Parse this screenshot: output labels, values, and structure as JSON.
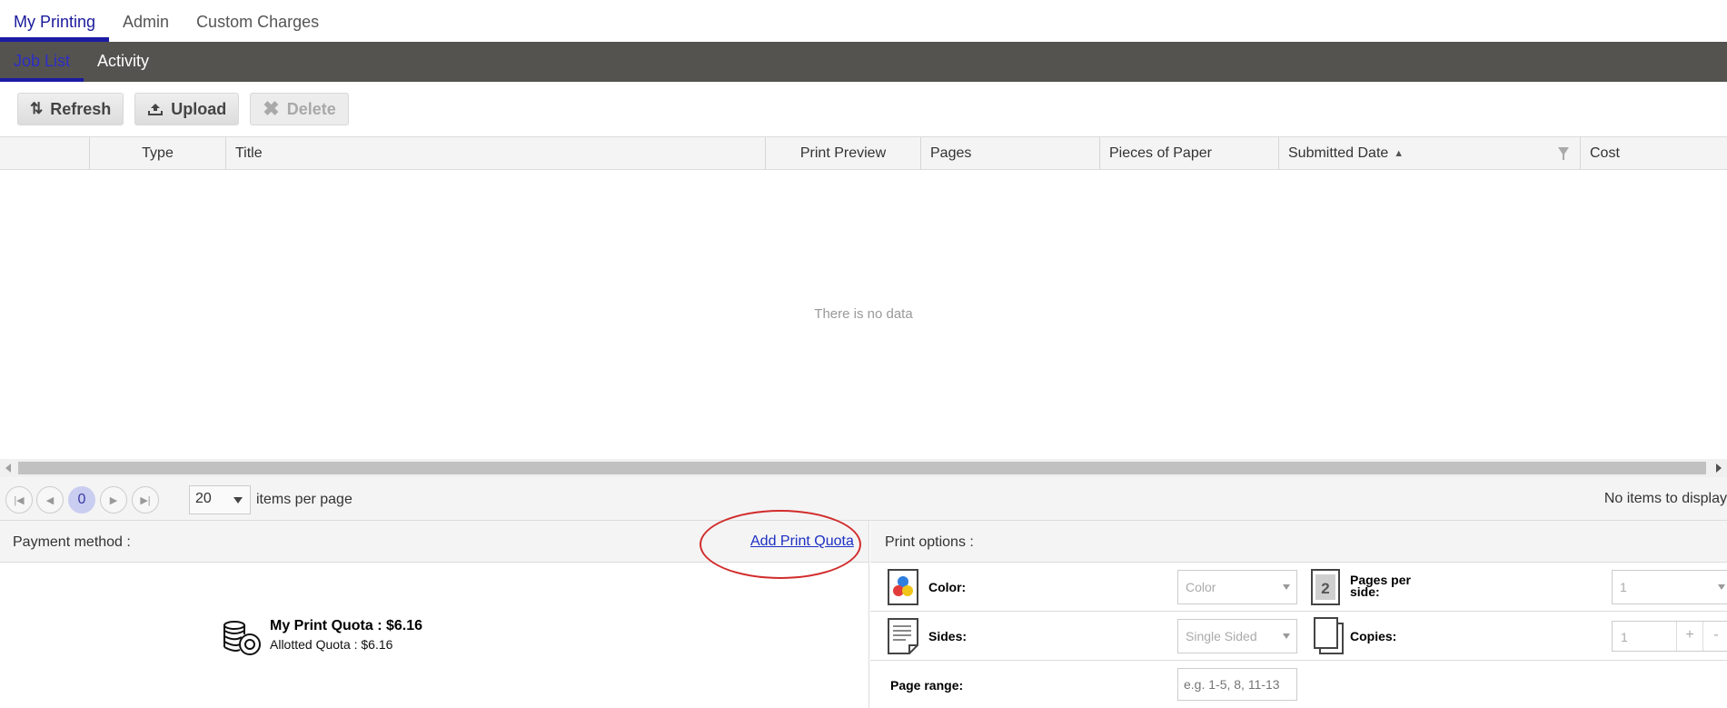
{
  "top_tabs": [
    "My Printing",
    "Admin",
    "Custom Charges"
  ],
  "sub_tabs": [
    "Job List",
    "Activity"
  ],
  "toolbar": {
    "refresh": "Refresh",
    "upload": "Upload",
    "delete": "Delete"
  },
  "grid": {
    "columns": [
      "Type",
      "Title",
      "Print Preview",
      "Pages",
      "Pieces of Paper",
      "Submitted Date",
      "Cost"
    ],
    "empty_message": "There is no data"
  },
  "pager": {
    "current_page": "0",
    "page_size": "20",
    "items_per_page_label": "items per page",
    "status": "No items to display"
  },
  "payment": {
    "label": "Payment method :",
    "add_quota_link": "Add Print Quota",
    "quota_title": "My Print Quota : $6.16",
    "quota_allotted": "Allotted Quota : $6.16"
  },
  "print_options": {
    "label": "Print options :",
    "color_label": "Color:",
    "color_value": "Color",
    "pages_per_side_label": "Pages per side:",
    "pages_per_side_value": "1",
    "pages_per_side_icon_text": "2",
    "sides_label": "Sides:",
    "sides_value": "Single Sided",
    "copies_label": "Copies:",
    "copies_value": "1",
    "page_range_label": "Page range:",
    "page_range_placeholder": "e.g. 1-5, 8, 11-13"
  },
  "colors": {
    "accent": "#1b1ba3",
    "subnav_bg": "#545350",
    "link": "#1c2fc4",
    "annotation": "#d22c2c"
  }
}
